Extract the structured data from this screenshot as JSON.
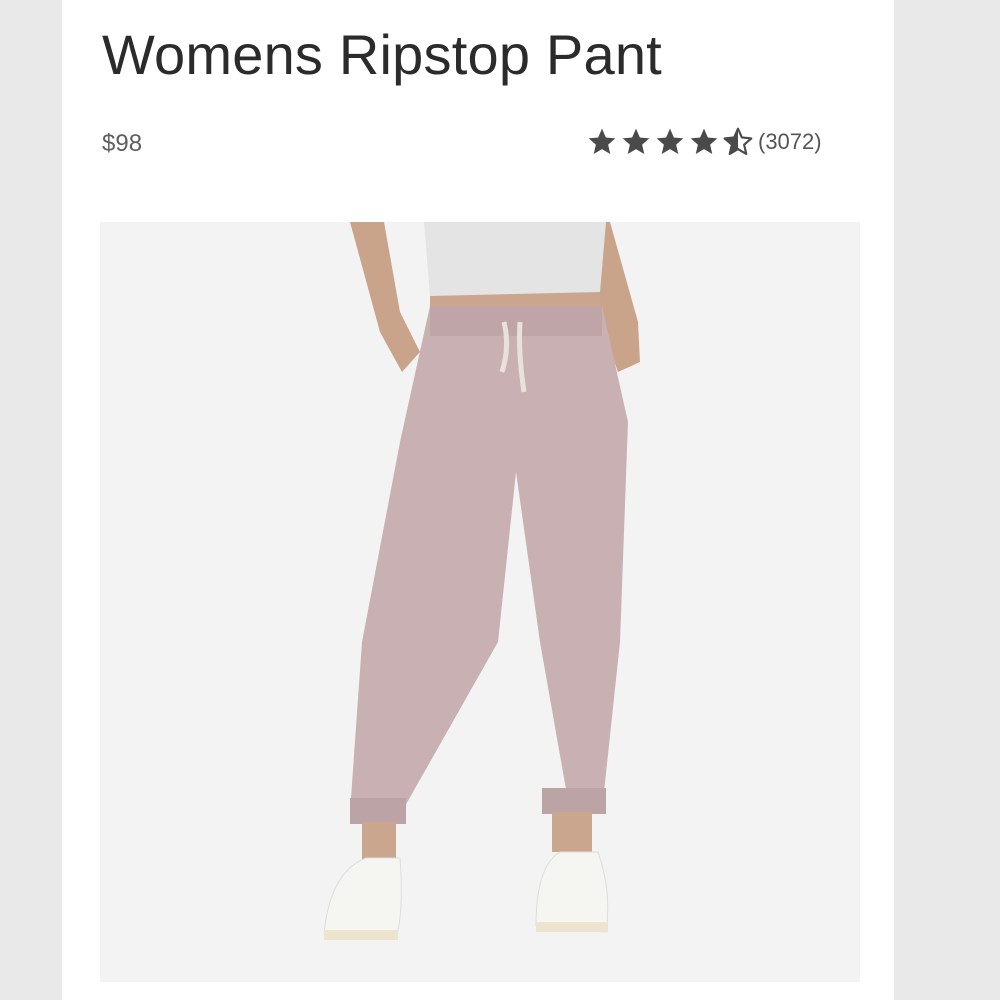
{
  "product": {
    "title": "Womens Ripstop Pant",
    "price": "$98",
    "rating": {
      "stars_value": 4.5,
      "stars_max": 5,
      "review_count": "(3072)",
      "star_color": "#4a4a4a"
    },
    "image": {
      "icon": "product-photo",
      "pant_color": "#c9b1b3",
      "top_color": "#e4e4e4",
      "shoe_color": "#f5f5f2"
    }
  }
}
